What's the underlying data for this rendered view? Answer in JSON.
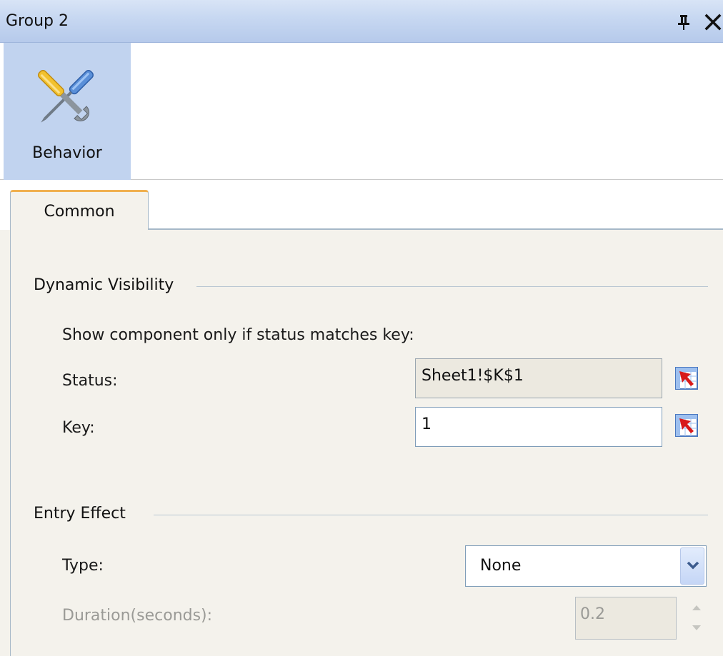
{
  "window": {
    "title": "Group 2",
    "pin_icon": "pin-icon",
    "close_icon": "close-icon"
  },
  "categories": [
    {
      "label": "Behavior",
      "icon": "tools-icon",
      "selected": true
    }
  ],
  "tabs": [
    {
      "label": "Common",
      "selected": true
    }
  ],
  "dynamic_visibility": {
    "header": "Dynamic Visibility",
    "description": "Show component only if status matches key:",
    "status_label": "Status:",
    "status_value": "Sheet1!$K$1",
    "key_label": "Key:",
    "key_value": "1",
    "cell_picker_icon": "cell-picker-icon"
  },
  "entry_effect": {
    "header": "Entry Effect",
    "type_label": "Type:",
    "type_value": "None",
    "duration_label": "Duration(seconds):",
    "duration_value": "0.2"
  },
  "colors": {
    "title_bar": "#c6d7f1",
    "selected_category": "#c1d3ef",
    "tab_accent": "#f0b050",
    "panel_background": "#f4f2ec",
    "disabled_text": "#9a9a96"
  }
}
